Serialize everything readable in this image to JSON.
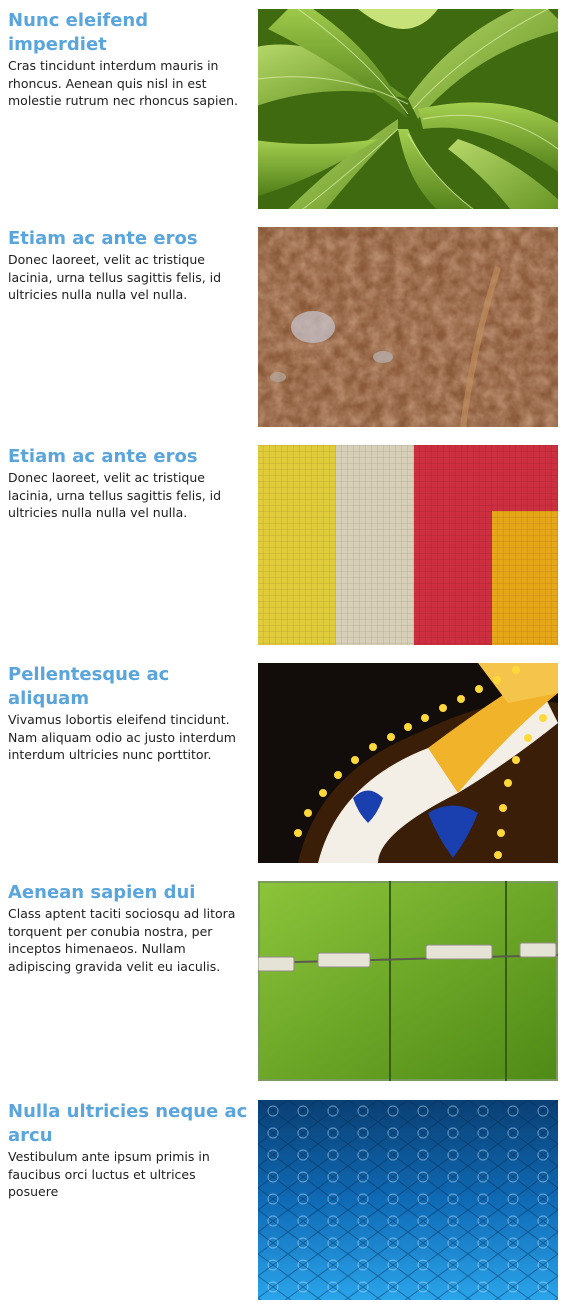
{
  "items": [
    {
      "title": "Nunc eleifend imperdiet",
      "body": "Cras tincidunt interdum mauris in rhoncus. Aenean quis nisl in est molestie rutrum nec rhoncus sapien."
    },
    {
      "title": "Etiam ac ante eros",
      "body": "Donec laoreet, velit ac tristique lacinia, urna tellus sagittis felis, id ultricies nulla nulla vel nulla."
    },
    {
      "title": "Etiam ac ante eros",
      "body": "Donec laoreet, velit ac tristique lacinia, urna tellus sagittis felis, id ultricies nulla nulla vel nulla."
    },
    {
      "title": "Pellentesque ac aliquam",
      "body": "Vivamus lobortis eleifend tincidunt. Nam aliquam odio ac justo interdum interdum ultricies nunc porttitor."
    },
    {
      "title": "Aenean sapien dui",
      "body": "Class aptent taciti sociosqu ad litora torquent per conubia nostra, per inceptos himenaeos. Nullam adipiscing gravida velit eu iaculis."
    },
    {
      "title": "Nulla ultricies neque ac arcu",
      "body": "Vestibulum ante ipsum primis in faucibus orci luctus et ultrices posuere"
    }
  ],
  "colors": {
    "heading": "#5aa5dc",
    "body_text": "#1e1e1e",
    "background": "#ffffff"
  }
}
